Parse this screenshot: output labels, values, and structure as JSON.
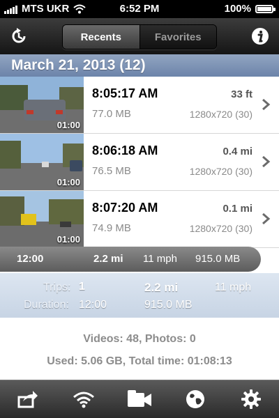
{
  "status_bar": {
    "carrier": "MTS UKR",
    "time": "6:52 PM",
    "battery": "100%",
    "signal_bars": 4,
    "battery_level": 1.0
  },
  "nav": {
    "tabs": [
      {
        "label": "Recents",
        "active": true
      },
      {
        "label": "Favorites",
        "active": false
      }
    ],
    "left_icon": "clock-refresh-icon",
    "right_icon": "info-icon"
  },
  "section": {
    "title": "March 21, 2013 (12)"
  },
  "rows": [
    {
      "time": "8:05:17 AM",
      "distance": "33 ft",
      "size": "77.0 MB",
      "resolution": "1280x720 (30)",
      "duration": "01:00"
    },
    {
      "time": "8:06:18 AM",
      "distance": "0.4 mi",
      "size": "76.5 MB",
      "resolution": "1280x720 (30)",
      "duration": "01:00"
    },
    {
      "time": "8:07:20 AM",
      "distance": "0.1 mi",
      "size": "74.9 MB",
      "resolution": "1280x720 (30)",
      "duration": "01:00"
    }
  ],
  "summary_bar": {
    "duration": "12:00",
    "distance": "2.2 mi",
    "speed": "11 mph",
    "size": "915.0 MB"
  },
  "totals": {
    "trips_label": "Trips:",
    "trips_value": "1",
    "distance": "2.2 mi",
    "speed": "11 mph",
    "duration_label": "Duration:",
    "duration_value": "12:00",
    "size": "915.0 MB"
  },
  "stats": {
    "media": "Videos: 48, Photos: 0",
    "usage": "Used: 5.06 GB, Total time: 01:08:13"
  },
  "toolbar": {
    "icons": [
      "share-icon",
      "wifi-icon",
      "video-camera-icon",
      "globe-icon",
      "gear-icon"
    ]
  },
  "colors": {
    "section_header": "#7f95b8",
    "summary_bar": "#6e6e6e",
    "totals_background": "#d2dcea"
  }
}
